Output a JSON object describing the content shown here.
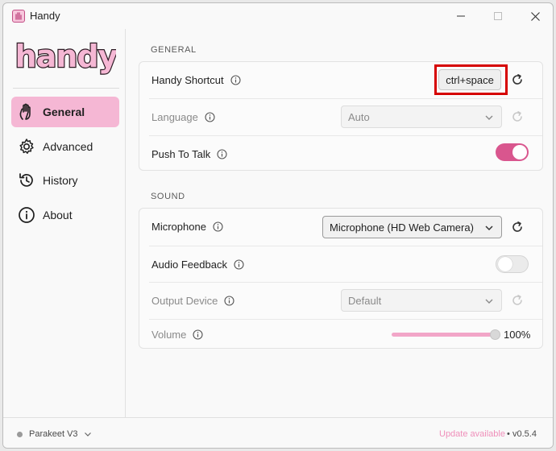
{
  "window": {
    "title": "Handy"
  },
  "sidebar": {
    "logo_text": "handy",
    "items": [
      {
        "label": "General",
        "icon": "hand-icon",
        "active": true
      },
      {
        "label": "Advanced",
        "icon": "gear-icon",
        "active": false
      },
      {
        "label": "History",
        "icon": "history-icon",
        "active": false
      },
      {
        "label": "About",
        "icon": "info-icon",
        "active": false
      }
    ]
  },
  "general": {
    "section_title": "GENERAL",
    "shortcut": {
      "label": "Handy Shortcut",
      "value": "ctrl+space"
    },
    "language": {
      "label": "Language",
      "value": "Auto",
      "disabled": true
    },
    "push_to_talk": {
      "label": "Push To Talk",
      "enabled": true
    }
  },
  "sound": {
    "section_title": "SOUND",
    "microphone": {
      "label": "Microphone",
      "value": "Microphone (HD Web Camera)"
    },
    "audio_feedback": {
      "label": "Audio Feedback",
      "enabled": false
    },
    "output_device": {
      "label": "Output Device",
      "value": "Default",
      "disabled": true
    },
    "volume": {
      "label": "Volume",
      "value": "100%",
      "level": 1.0,
      "disabled": true
    }
  },
  "footer": {
    "model": "Parakeet V3",
    "update": "Update available",
    "separator": "•",
    "version": "v0.5.4"
  },
  "colors": {
    "accent": "#d9568e",
    "active_nav": "#f5b7d4",
    "update_text": "#ef8fba",
    "highlight": "#d60000"
  }
}
